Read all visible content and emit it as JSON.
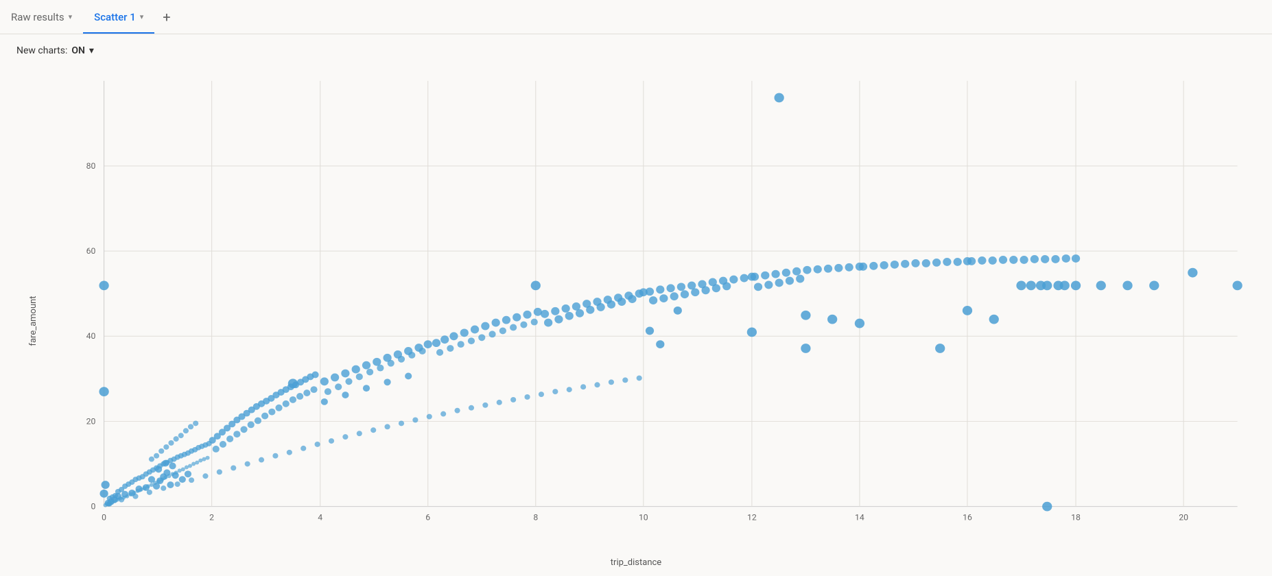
{
  "tabs": [
    {
      "id": "raw-results",
      "label": "Raw results",
      "active": false
    },
    {
      "id": "scatter-1",
      "label": "Scatter 1",
      "active": true
    }
  ],
  "add_tab_label": "+",
  "toolbar": {
    "new_charts_label": "New charts:",
    "new_charts_value": "ON",
    "chevron": "▾"
  },
  "chart": {
    "x_axis_label": "trip_distance",
    "y_axis_label": "fare_amount",
    "x_ticks": [
      0,
      2,
      4,
      6,
      8,
      10,
      12,
      14,
      16,
      18,
      20
    ],
    "y_ticks": [
      0,
      20,
      40,
      60,
      80
    ],
    "accent_color": "#4a9fd4",
    "background_color": "#faf9f7",
    "grid_color": "#e8e5e0"
  }
}
